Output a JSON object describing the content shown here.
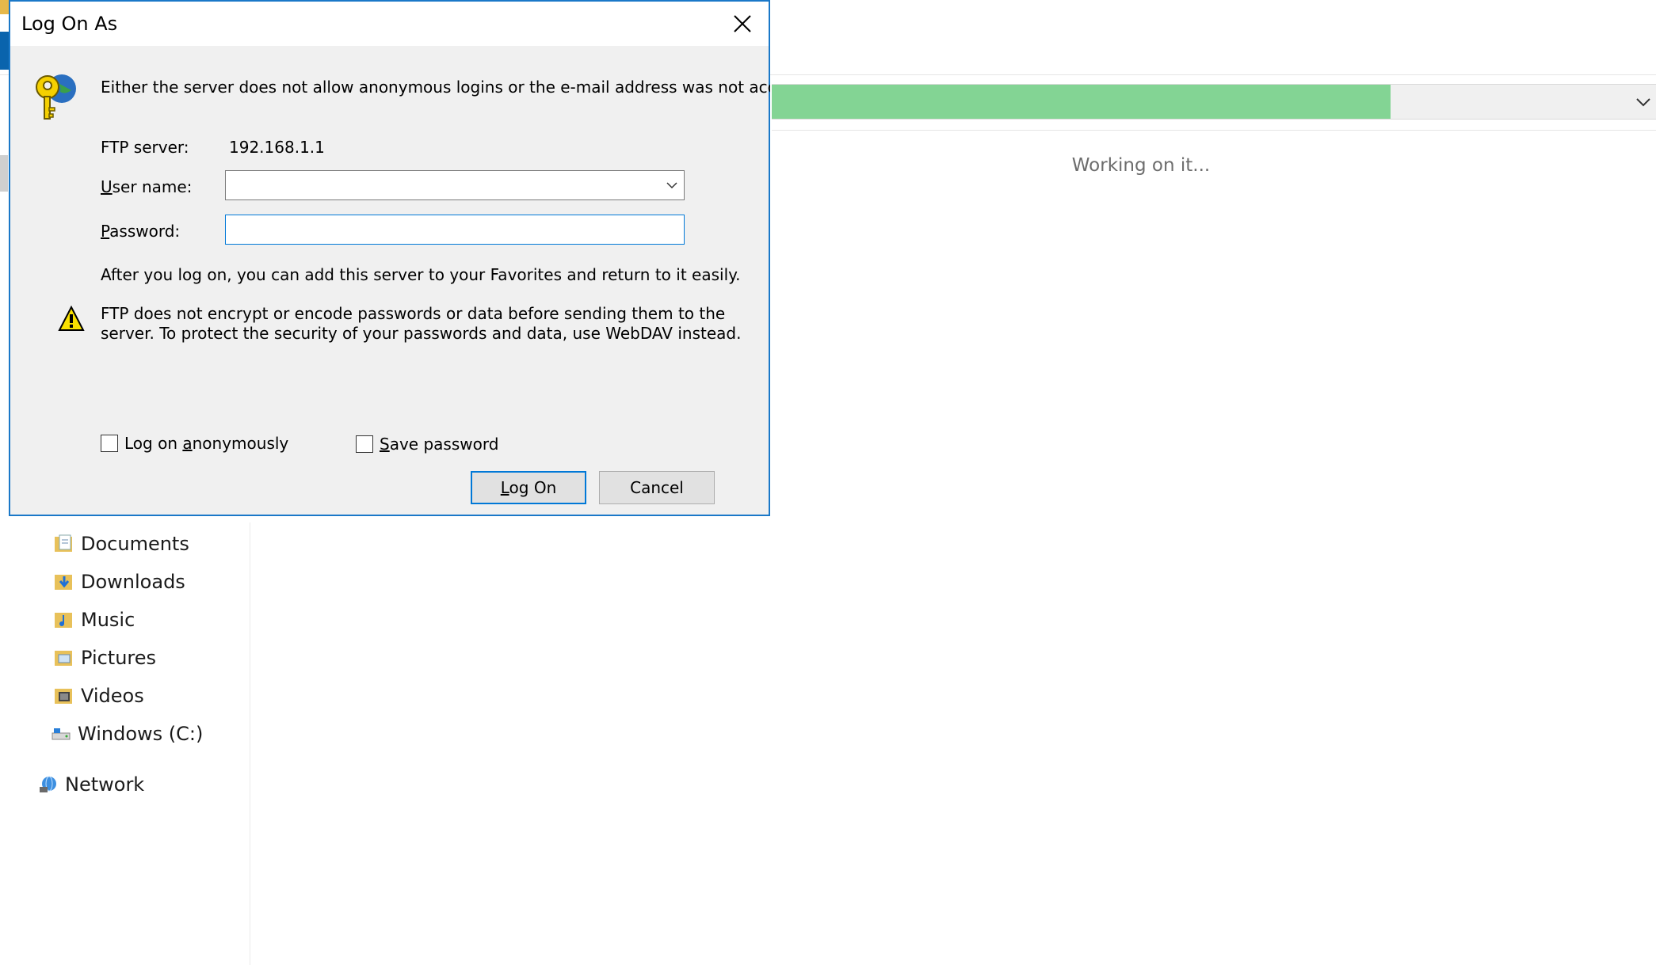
{
  "background": {
    "address_progress_percent": 70,
    "status_text": "Working on it...",
    "nav_items": [
      {
        "label": "Documents",
        "icon": "documents-folder-icon"
      },
      {
        "label": "Downloads",
        "icon": "downloads-folder-icon"
      },
      {
        "label": "Music",
        "icon": "music-folder-icon"
      },
      {
        "label": "Pictures",
        "icon": "pictures-folder-icon"
      },
      {
        "label": "Videos",
        "icon": "videos-folder-icon"
      },
      {
        "label": "Windows (C:)",
        "icon": "drive-icon"
      },
      {
        "label": "Network",
        "icon": "network-icon"
      }
    ]
  },
  "dialog": {
    "title": "Log On As",
    "message": "Either the server does not allow anonymous logins or the e-mail address was not accepted.",
    "ftp_server_label": "FTP server:",
    "ftp_server_value": "192.168.1.1",
    "username_label_accel": "U",
    "username_label_rest": "ser name:",
    "username_value": "",
    "password_label_accel": "P",
    "password_label_rest": "assword:",
    "password_value": "",
    "info_text": "After you log on, you can add this server to your Favorites and return to it easily.",
    "warning_line1": "FTP does not encrypt or encode passwords or data before sending them to the",
    "warning_line2": "server.  To protect the security of your passwords and data, use WebDAV instead.",
    "anon_label_pre": "Log on ",
    "anon_label_accel": "a",
    "anon_label_post": "nonymously",
    "save_label_accel": "S",
    "save_label_rest": "ave password",
    "logon_accel": "L",
    "logon_rest": "og On",
    "cancel_label": "Cancel"
  },
  "colors": {
    "accent": "#0078d7",
    "progress_green": "#83d494",
    "dialog_bg": "#f0f0f0"
  }
}
